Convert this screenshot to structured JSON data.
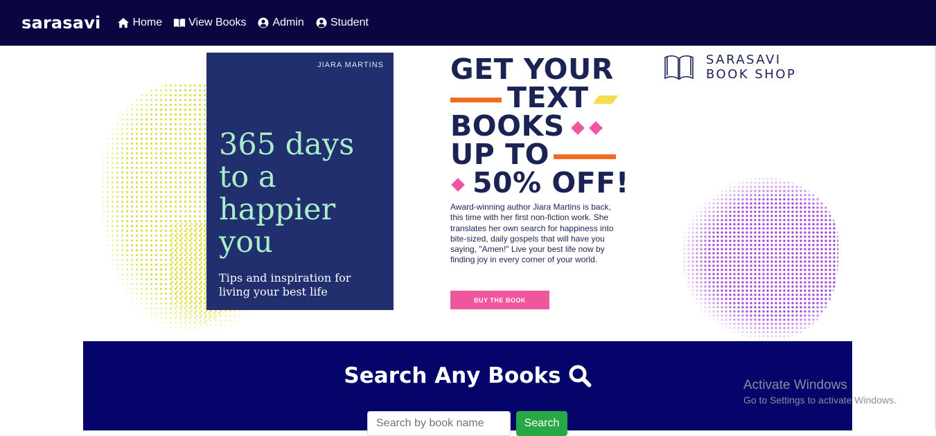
{
  "navbar": {
    "brand": "sarasavi",
    "items": [
      {
        "label": "Home",
        "icon": "home-icon"
      },
      {
        "label": "View Books",
        "icon": "book-open-icon"
      },
      {
        "label": "Admin",
        "icon": "user-circle-icon"
      },
      {
        "label": "Student",
        "icon": "user-circle-icon"
      }
    ],
    "background": "#0b0541"
  },
  "banner": {
    "book": {
      "author": "JIARA MARTINS",
      "title": "365 days to a happier you",
      "subtitle": "Tips and inspiration for living your best life",
      "cover_color": "#222f6e"
    },
    "promo": {
      "lines": [
        "GET YOUR",
        "TEXT",
        "BOOKS",
        "UP TO",
        "50% OFF!"
      ],
      "description": "Award-winning author Jiara Martins is back, this time with her first non-fiction work. She translates her own search for happiness into bite-sized, daily gospels that will have you saying, \"Amen!\" Live your best life now by finding joy in every corner of your world.",
      "button": "BUY THE BOOK",
      "accent_orange": "#f26b22",
      "accent_pink": "#f0569d",
      "accent_yellow": "#f7dc4f"
    },
    "shop": {
      "line1": "SARASAVI",
      "line2": "BOOK SHOP"
    }
  },
  "search": {
    "title": "Search Any Books",
    "placeholder": "Search by book name",
    "value": "",
    "button": "Search",
    "background": "#04046b",
    "button_color": "#28a745"
  },
  "watermark": {
    "title": "Activate Windows",
    "subtitle": "Go to Settings to activate Windows."
  }
}
